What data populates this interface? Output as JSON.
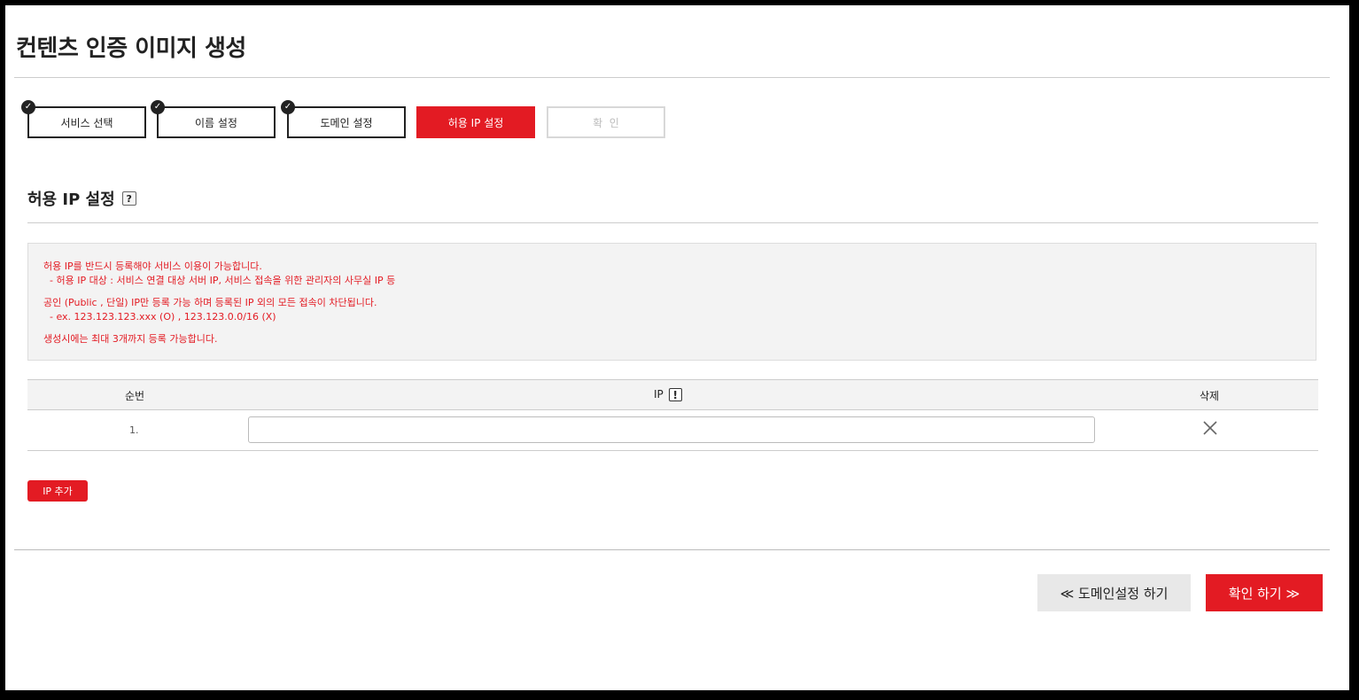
{
  "page": {
    "title": "컨텐츠 인증 이미지 생성"
  },
  "steps": [
    {
      "label": "서비스 선택",
      "state": "done"
    },
    {
      "label": "이름 설정",
      "state": "done"
    },
    {
      "label": "도메인 설정",
      "state": "done"
    },
    {
      "label": "허용 IP 설정",
      "state": "active"
    },
    {
      "label": "확  인",
      "state": "disabled"
    }
  ],
  "section": {
    "title": "허용 IP 설정",
    "help_icon_text": "?"
  },
  "notice": {
    "line1": "허용 IP를 반드시 등록해야 서비스 이용이 가능합니다.",
    "line2": "  - 허용 IP 대상 : 서비스 연결 대상 서버 IP, 서비스 접속을 위한 관리자의 사무실 IP 등",
    "line3": "공인 (Public , 단일) IP만 등록 가능 하며 등록된 IP 외의 모든 접속이 차단됩니다.",
    "line4": "  - ex. 123.123.123.xxx (O) , 123.123.0.0/16 (X)",
    "line5": "생성시에는 최대 3개까지 등록 가능합니다."
  },
  "table": {
    "headers": {
      "no": "순번",
      "ip": "IP",
      "ip_icon_text": "!",
      "delete": "삭제"
    },
    "rows": [
      {
        "no": "1.",
        "ip_value": ""
      }
    ]
  },
  "buttons": {
    "add_ip": "IP 추가",
    "prev": "≪ 도메인설정 하기",
    "next": "확인 하기 ≫"
  },
  "colors": {
    "accent": "#e31b23",
    "notice_text": "#e31b23",
    "notice_bg": "#f3f3f3"
  },
  "icons": {
    "step_done": "check-circle-icon",
    "delete": "close-icon"
  }
}
